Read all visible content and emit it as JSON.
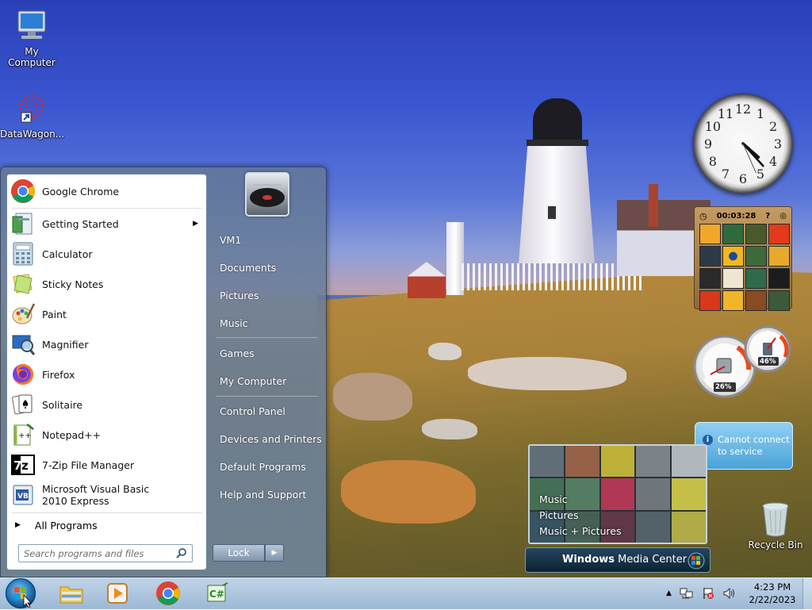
{
  "desktop": {
    "icons": [
      {
        "label": "My Computer",
        "icon": "computer-icon"
      },
      {
        "label": "DataWagon...",
        "icon": "datawagon-shortcut-icon"
      },
      {
        "label": "Recycle Bin",
        "icon": "recycle-bin-icon"
      }
    ]
  },
  "start_menu": {
    "programs": [
      {
        "label": "Google Chrome",
        "icon": "chrome-icon"
      },
      {
        "label": "Getting Started",
        "icon": "getting-started-icon",
        "submenu": true
      },
      {
        "label": "Calculator",
        "icon": "calculator-icon"
      },
      {
        "label": "Sticky Notes",
        "icon": "sticky-notes-icon"
      },
      {
        "label": "Paint",
        "icon": "paint-icon"
      },
      {
        "label": "Magnifier",
        "icon": "magnifier-icon"
      },
      {
        "label": "Firefox",
        "icon": "firefox-icon"
      },
      {
        "label": "Solitaire",
        "icon": "solitaire-icon"
      },
      {
        "label": "Notepad++",
        "icon": "notepadpp-icon"
      },
      {
        "label": "7-Zip File Manager",
        "icon": "7zip-icon"
      },
      {
        "label": "Microsoft Visual Basic 2010 Express",
        "icon": "visual-basic-icon"
      }
    ],
    "all_programs": "All Programs",
    "search_placeholder": "Search programs and files",
    "right_links": [
      {
        "label": "VM1"
      },
      {
        "label": "Documents"
      },
      {
        "label": "Pictures"
      },
      {
        "label": "Music"
      },
      {
        "label": "Games"
      },
      {
        "label": "My Computer"
      },
      {
        "label": "Control Panel"
      },
      {
        "label": "Devices and Printers"
      },
      {
        "label": "Default Programs"
      },
      {
        "label": "Help and Support"
      }
    ],
    "lock_label": "Lock"
  },
  "gadgets": {
    "clock": {
      "hour": 4,
      "minute": 23
    },
    "puzzle_timer": "00:03:28",
    "cpu_meter": {
      "cpu": "26%",
      "memory": "46%"
    },
    "weather_message": "Cannot connect to service",
    "media_center": {
      "menu": [
        "Music",
        "Pictures",
        "Music + Pictures"
      ],
      "brand_bold": "Windows",
      "brand_rest": " Media Center"
    }
  },
  "taskbar": {
    "pinned": [
      {
        "icon": "explorer-folder-icon"
      },
      {
        "icon": "media-player-icon"
      },
      {
        "icon": "chrome-icon"
      },
      {
        "icon": "csharp-icon"
      }
    ],
    "time": "4:23 PM",
    "date": "2/22/2023"
  },
  "colors": {
    "accent": "#2a7fc4",
    "menu_text": "#ffffff"
  }
}
